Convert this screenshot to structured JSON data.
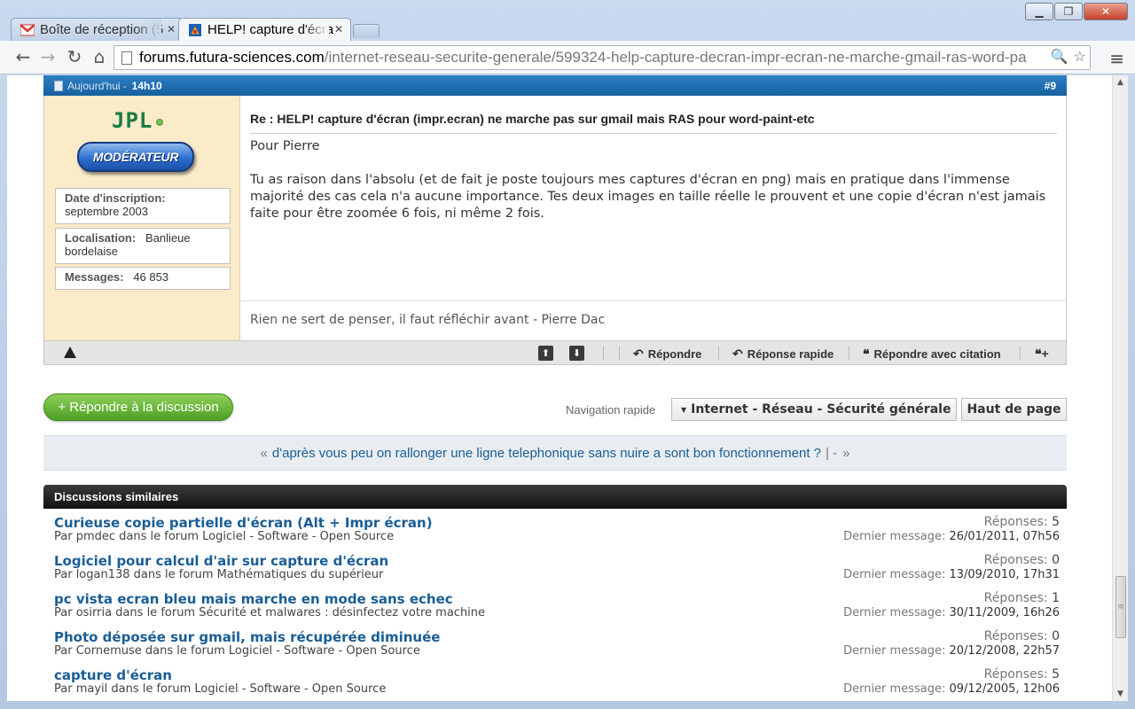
{
  "browser": {
    "tabs": [
      {
        "title": "Boîte de réception (5",
        "active": false
      },
      {
        "title": "HELP! capture d'écra",
        "active": true
      }
    ],
    "url_host": "forums.futura-sciences.com",
    "url_path": "/internet-reseau-securite-generale/599324-help-capture-decran-impr-ecran-ne-marche-gmail-ras-word-pa"
  },
  "post": {
    "date": "Aujourd'hui",
    "time": "14h10",
    "number": "#9",
    "username": "JPL",
    "badge": "MODÉRATEUR",
    "join_label": "Date d'inscription:",
    "join_value": "septembre 2003",
    "location_label": "Localisation:",
    "location_value": "Banlieue bordelaise",
    "messages_label": "Messages:",
    "messages_value": "46 853",
    "title": "Re : HELP! capture d'écran (impr.ecran) ne marche pas sur gmail mais RAS pour word-paint-etc",
    "paragraph1": "Pour Pierre",
    "paragraph2": "Tu as raison dans l'absolu (et de fait je poste toujours mes captures d'écran en png) mais en pratique dans l'immense majorité des cas cela n'a aucune importance. Tes deux images en taille réelle le prouvent et une copie d'écran n'est jamais faite pour être zoomée 6 fois, ni même 2 fois.",
    "signature": "Rien ne sert de penser, il faut réfléchir avant - Pierre Dac",
    "footer": {
      "reply": "Répondre",
      "quick_reply": "Réponse rapide",
      "quote_reply": "Répondre avec citation"
    }
  },
  "actions": {
    "reply_thread": "+ Répondre à la discussion",
    "nav_label": "Navigation rapide",
    "nav_value": "Internet - Réseau - Sécurité générale",
    "top": "Haut de page"
  },
  "thread_nav": {
    "prev_arrow": "«",
    "prev_title": "d'après vous peu on rallonger une ligne telephonique sans nuire a sont bon fonctionnement ?",
    "separator": "| -",
    "next_arrow": "»"
  },
  "similar": {
    "header": "Discussions similaires",
    "replies_label": "Réponses:",
    "last_label": "Dernier message:",
    "items": [
      {
        "title": "Curieuse copie partielle d'écran (Alt + Impr écran)",
        "meta": "Par pmdec dans le forum Logiciel - Software - Open Source",
        "replies": "5",
        "last": "26/01/2011, 07h56"
      },
      {
        "title": "Logiciel pour calcul d'air sur capture d'écran",
        "meta": "Par logan138 dans le forum Mathématiques du supérieur",
        "replies": "0",
        "last": "13/09/2010, 17h31"
      },
      {
        "title": "pc vista ecran bleu mais marche en mode sans echec",
        "meta": "Par osirria dans le forum Sécurité et malwares : désinfectez votre machine",
        "replies": "1",
        "last": "30/11/2009, 16h26"
      },
      {
        "title": "Photo déposée sur gmail, mais récupérée diminuée",
        "meta": "Par Cornemuse dans le forum Logiciel - Software - Open Source",
        "replies": "0",
        "last": "20/12/2008, 22h57"
      },
      {
        "title": "capture d'écran",
        "meta": "Par mayil dans le forum Logiciel - Software - Open Source",
        "replies": "5",
        "last": "09/12/2005, 12h06"
      }
    ]
  },
  "colors": {
    "post_header": "#1e6fb2",
    "userinfo_bg": "#fcebc8",
    "username": "#1c7a47",
    "link": "#1a5d95",
    "reply_button": "#5aab2e"
  }
}
